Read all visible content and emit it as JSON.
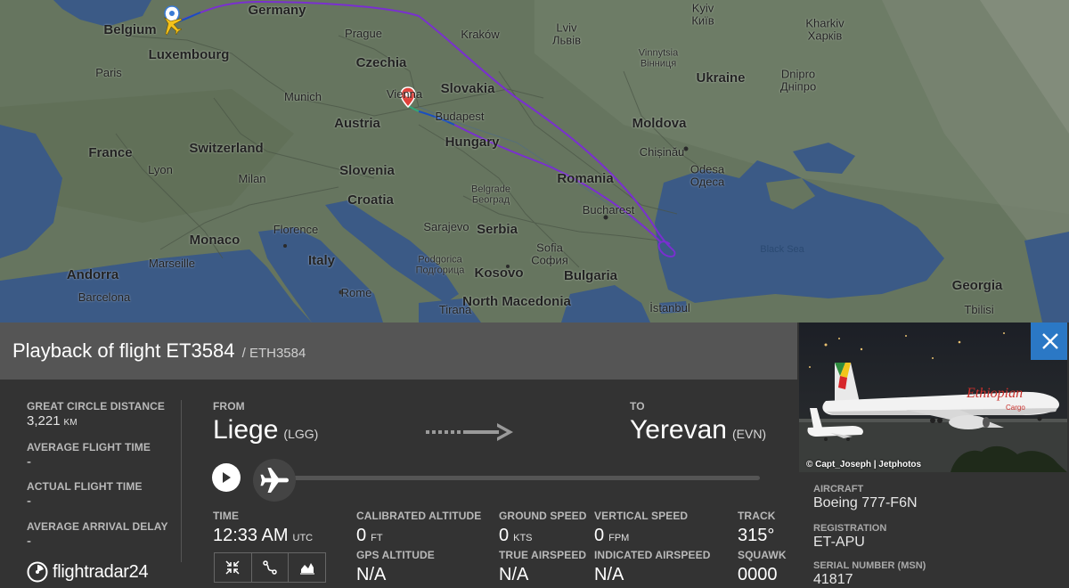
{
  "map": {
    "countries": [
      "Germany",
      "Belgium",
      "Luxembourg",
      "Czechia",
      "Slovakia",
      "Austria",
      "Hungary",
      "Switzerland",
      "France",
      "Slovenia",
      "Croatia",
      "Serbia",
      "Romania",
      "Moldova",
      "Ukraine",
      "Bulgaria",
      "Kosovo",
      "North Macedonia",
      "Italy",
      "Monaco",
      "Andorra",
      "Georgia"
    ],
    "cities": [
      "Paris",
      "Prague",
      "Kraków",
      "Lviv\nЛьвів",
      "Kyiv\nКиїв",
      "Kharkiv\nХарків",
      "Vinnytsia\nВінниця",
      "Dnipro\nДніпро",
      "Munich",
      "Vienna",
      "Budapest",
      "Lyon",
      "Milan",
      "Chișinău",
      "Odesa\nОдеса",
      "Belgrade\nБеоград",
      "Bucharest",
      "Sarajevo",
      "Florence",
      "Marseille",
      "Barcelona",
      "Rome",
      "Sofia\nСофия",
      "Podgorica\nПодгорица",
      "Tirana",
      "İstanbul",
      "Tbilisi"
    ],
    "sea_label": "Black Sea",
    "colors": {
      "route_purple": "#7a2fd0",
      "route_blue": "#1a4fc0",
      "route_green": "#2fa87a",
      "aircraft_yellow": "#f5c21b",
      "origin_pin": "#ffffff",
      "current_pin": "#e0413a"
    }
  },
  "header": {
    "title": "Playback of flight ET3584",
    "callsign": "/ ETH3584"
  },
  "stats": {
    "great_circle_label": "GREAT CIRCLE DISTANCE",
    "great_circle_value": "3,221",
    "great_circle_unit": "KM",
    "avg_flight_time_label": "AVERAGE FLIGHT TIME",
    "avg_flight_time_value": "-",
    "actual_flight_time_label": "ACTUAL FLIGHT TIME",
    "actual_flight_time_value": "-",
    "avg_arrival_delay_label": "AVERAGE ARRIVAL DELAY",
    "avg_arrival_delay_value": "-"
  },
  "route": {
    "from_label": "FROM",
    "from_city": "Liege",
    "from_code": "(LGG)",
    "to_label": "TO",
    "to_city": "Yerevan",
    "to_code": "(EVN)"
  },
  "playback": {
    "progress": 0,
    "play_icon": "play-icon",
    "thumb_icon": "airplane-icon"
  },
  "telemetry": {
    "time_label": "TIME",
    "time_value": "12:33 AM",
    "time_unit": "UTC",
    "cal_alt_label": "CALIBRATED ALTITUDE",
    "cal_alt_value": "0",
    "cal_alt_unit": "FT",
    "gps_alt_label": "GPS ALTITUDE",
    "gps_alt_value": "N/A",
    "ground_speed_label": "GROUND SPEED",
    "ground_speed_value": "0",
    "ground_speed_unit": "KTS",
    "true_airspeed_label": "TRUE AIRSPEED",
    "true_airspeed_value": "N/A",
    "vertical_speed_label": "VERTICAL SPEED",
    "vertical_speed_value": "0",
    "vertical_speed_unit": "FPM",
    "indicated_airspeed_label": "INDICATED AIRSPEED",
    "indicated_airspeed_value": "N/A",
    "track_label": "TRACK",
    "track_value": "315°",
    "squawk_label": "SQUAWK",
    "squawk_value": "0000"
  },
  "view_buttons": [
    "collapse-icon",
    "route-icon",
    "chart-icon"
  ],
  "brand": {
    "name": "flightradar24"
  },
  "aircraft": {
    "photo_credit": "© Capt_Joseph | Jetphotos",
    "aircraft_label": "AIRCRAFT",
    "aircraft_value": "Boeing 777-F6N",
    "registration_label": "REGISTRATION",
    "registration_value": "ET-APU",
    "serial_label": "SERIAL NUMBER (MSN)",
    "serial_value": "41817",
    "livery_text": "Ethiopian",
    "livery_sub": "Cargo"
  }
}
